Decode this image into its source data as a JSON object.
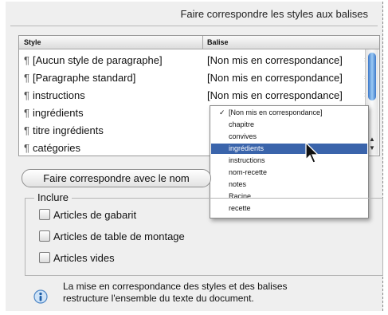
{
  "dialog": {
    "title": "Faire correspondre les styles aux balises"
  },
  "table": {
    "headers": {
      "style": "Style",
      "balise": "Balise"
    },
    "rows": [
      {
        "style": "[Aucun style de paragraphe]",
        "balise": "[Non mis en correspondance]"
      },
      {
        "style": "[Paragraphe standard]",
        "balise": "[Non mis en correspondance]"
      },
      {
        "style": "instructions",
        "balise": "[Non mis en correspondance]"
      },
      {
        "style": "ingrédients",
        "balise": ""
      },
      {
        "style": "titre ingrédients",
        "balise": ""
      },
      {
        "style": "catégories",
        "balise": ""
      }
    ]
  },
  "dropdown": {
    "items": [
      {
        "label": "[Non mis en correspondance]",
        "checked": true,
        "selected": false
      },
      {
        "label": "chapitre",
        "checked": false,
        "selected": false
      },
      {
        "label": "convives",
        "checked": false,
        "selected": false
      },
      {
        "label": "ingrédients",
        "checked": false,
        "selected": true
      },
      {
        "label": "instructions",
        "checked": false,
        "selected": false
      },
      {
        "label": "nom-recette",
        "checked": false,
        "selected": false
      },
      {
        "label": "notes",
        "checked": false,
        "selected": false
      },
      {
        "label": "Racine",
        "checked": false,
        "selected": false
      },
      {
        "label": "recette",
        "checked": false,
        "selected": false
      }
    ]
  },
  "match_button": {
    "label": "Faire correspondre avec le nom"
  },
  "include": {
    "legend": "Inclure",
    "options": [
      {
        "label": "Articles de gabarit",
        "checked": false
      },
      {
        "label": "Articles de table de montage",
        "checked": false
      },
      {
        "label": "Articles vides",
        "checked": false
      }
    ]
  },
  "info": {
    "line1": "La mise en correspondance des styles et des balises",
    "line2": "restructure l'ensemble du texte du document."
  },
  "colors": {
    "selection": "#3a64ab",
    "scroll_thumb": "#5b95dc",
    "dialog_bg": "#efefef"
  }
}
